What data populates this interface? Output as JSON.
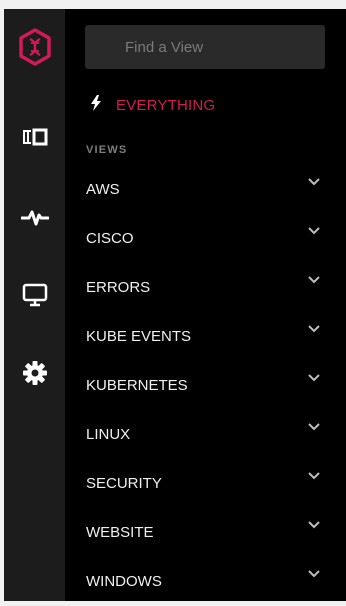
{
  "search": {
    "placeholder": "Find a View"
  },
  "everything": {
    "label": "EVERYTHING",
    "icon": "lightning-icon"
  },
  "views": {
    "heading": "VIEWS",
    "items": [
      {
        "label": "AWS"
      },
      {
        "label": "CISCO"
      },
      {
        "label": "ERRORS"
      },
      {
        "label": "KUBE EVENTS"
      },
      {
        "label": "KUBERNETES"
      },
      {
        "label": "LINUX"
      },
      {
        "label": "SECURITY"
      },
      {
        "label": "WEBSITE"
      },
      {
        "label": "WINDOWS"
      }
    ]
  },
  "rail": {
    "icons": [
      "logo-hexagon-icon",
      "streams-icon",
      "pulse-icon",
      "monitor-icon",
      "gear-icon"
    ]
  },
  "colors": {
    "accent": "#d21a5b",
    "rail_bg": "#1c1c1c",
    "panel_bg": "#000000",
    "search_bg": "#2a2a2a"
  }
}
